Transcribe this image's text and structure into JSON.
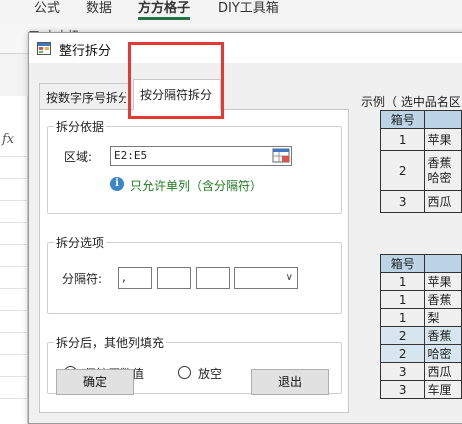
{
  "ribbon": {
    "tabs": [
      "公式",
      "数据",
      "方方格子",
      "DIY工具箱"
    ],
    "fragments": [
      "口 本中奶",
      "文本",
      "fx"
    ]
  },
  "dialog": {
    "title": "整行拆分",
    "tabs": [
      "按数字序号拆分",
      "按分隔符拆分"
    ],
    "basis": {
      "title": "拆分依据",
      "range_label": "区域:",
      "range_value": "E2:E5",
      "hint": "只允许单列（含分隔符）"
    },
    "options": {
      "title": "拆分选项",
      "sep_label": "分隔符:",
      "sep1": ",",
      "sep2": "",
      "sep3": ""
    },
    "fill": {
      "title": "拆分后，其他列填充",
      "keep": "保持原数值",
      "empty": "放空"
    },
    "ok": "确定",
    "exit": "退出"
  },
  "example": {
    "title": "示例（ 选中品名区",
    "table1": {
      "header": [
        "箱号",
        ""
      ],
      "rows": [
        [
          "1",
          "苹果"
        ],
        [
          "2",
          "香蕉\n哈密"
        ],
        [
          "3",
          "西瓜"
        ]
      ]
    },
    "table2": {
      "header": [
        "箱号",
        ""
      ],
      "rows": [
        [
          "1",
          "苹果"
        ],
        [
          "1",
          "香蕉"
        ],
        [
          "1",
          "梨"
        ],
        [
          "2",
          "香蕉"
        ],
        [
          "2",
          "哈密"
        ],
        [
          "3",
          "西瓜"
        ],
        [
          "3",
          "车厘"
        ]
      ]
    }
  },
  "colors": {
    "highlight": "#e53935",
    "hint_green": "#1e7a1e",
    "header_blue": "#bcd4e6",
    "row_highlight": "#d7e6ee"
  }
}
